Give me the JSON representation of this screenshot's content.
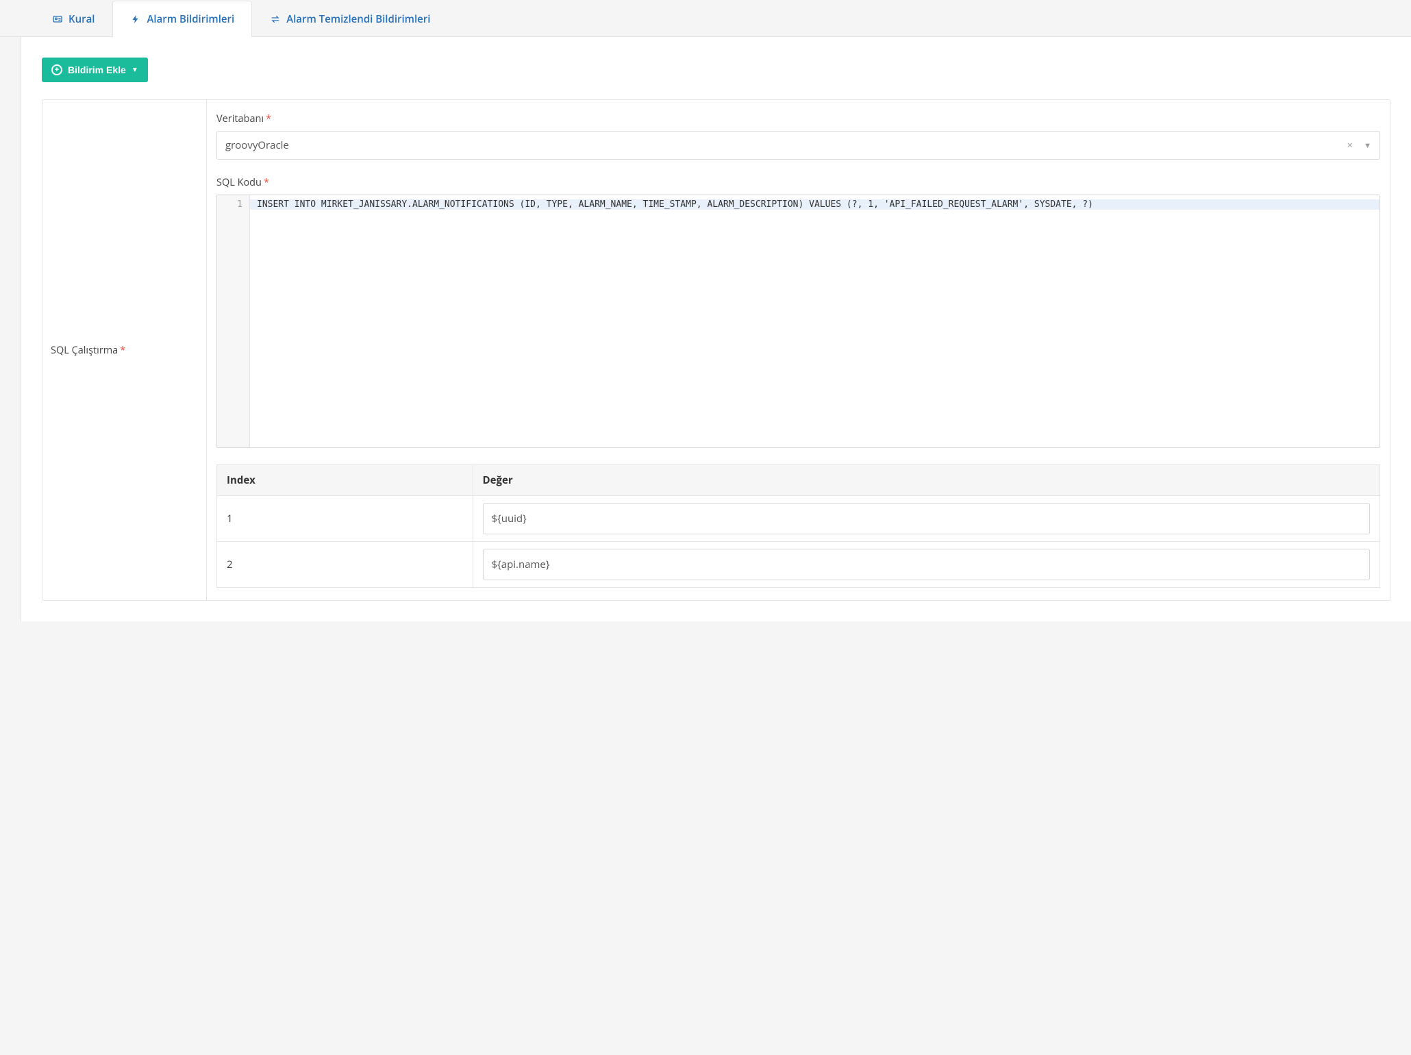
{
  "tabs": [
    {
      "label": "Kural",
      "icon": "id-card-icon",
      "active": false
    },
    {
      "label": "Alarm Bildirimleri",
      "icon": "bolt-icon",
      "active": true
    },
    {
      "label": "Alarm Temizlendi Bildirimleri",
      "icon": "swap-icon",
      "active": false
    }
  ],
  "addButton": {
    "label": "Bildirim Ekle"
  },
  "form": {
    "sideLabel": "SQL Çalıştırma",
    "database": {
      "label": "Veritabanı",
      "value": "groovyOracle"
    },
    "sqlCode": {
      "label": "SQL Kodu",
      "lineNumber": "1",
      "content": "INSERT INTO MIRKET_JANISSARY.ALARM_NOTIFICATIONS (ID, TYPE, ALARM_NAME, TIME_STAMP, ALARM_DESCRIPTION) VALUES (?, 1, 'API_FAILED_REQUEST_ALARM', SYSDATE, ?)"
    },
    "paramsTable": {
      "headers": {
        "index": "Index",
        "value": "Değer"
      },
      "rows": [
        {
          "index": "1",
          "value": "${uuid}"
        },
        {
          "index": "2",
          "value": "${api.name}"
        }
      ]
    }
  }
}
